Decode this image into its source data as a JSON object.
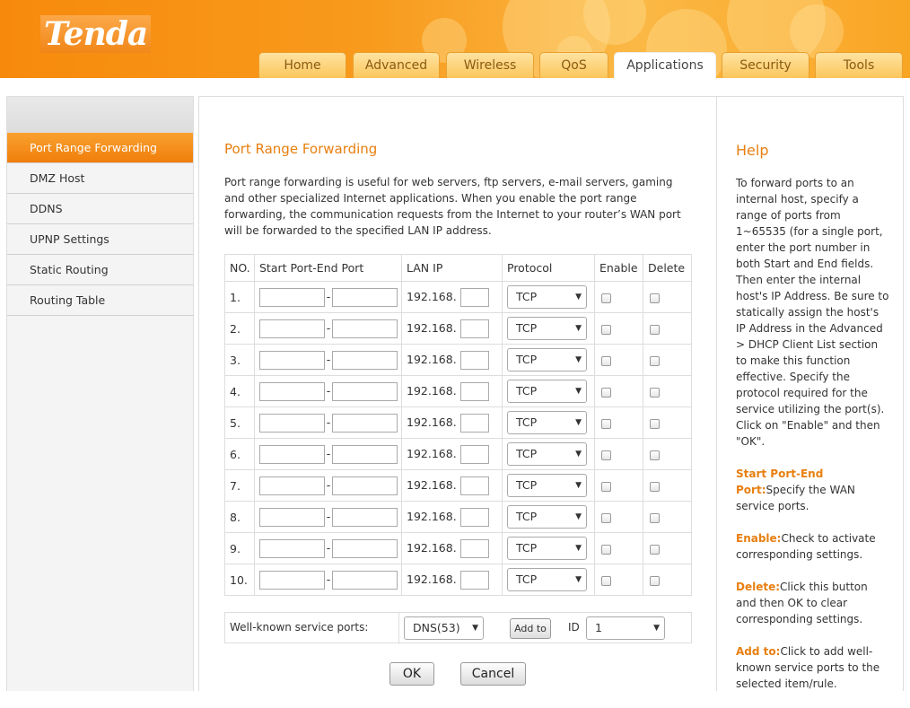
{
  "brand": {
    "logo_text": "Tenda"
  },
  "nav": {
    "tabs": [
      "Home",
      "Advanced",
      "Wireless",
      "QoS",
      "Applications",
      "Security",
      "Tools"
    ],
    "active": "Applications"
  },
  "sidebar": {
    "items": [
      "Port Range Forwarding",
      "DMZ Host",
      "DDNS",
      "UPNP Settings",
      "Static Routing",
      "Routing Table"
    ],
    "active": "Port Range Forwarding"
  },
  "main": {
    "title": "Port Range Forwarding",
    "intro": "Port range forwarding is useful for web servers, ftp servers, e-mail servers, gaming and other specialized Internet applications. When you enable the port range forwarding, the communication requests from the Internet to your router’s WAN port will be forwarded to the specified LAN IP address.",
    "table": {
      "headers": {
        "no": "NO.",
        "ports": "Start Port-End Port",
        "lan_ip": "LAN IP",
        "protocol": "Protocol",
        "enable": "Enable",
        "delete": "Delete"
      },
      "rows": [
        {
          "no": "1.",
          "ip_prefix": "192.168.",
          "protocol": "TCP"
        },
        {
          "no": "2.",
          "ip_prefix": "192.168.",
          "protocol": "TCP"
        },
        {
          "no": "3.",
          "ip_prefix": "192.168.",
          "protocol": "TCP"
        },
        {
          "no": "4.",
          "ip_prefix": "192.168.",
          "protocol": "TCP"
        },
        {
          "no": "5.",
          "ip_prefix": "192.168.",
          "protocol": "TCP"
        },
        {
          "no": "6.",
          "ip_prefix": "192.168.",
          "protocol": "TCP"
        },
        {
          "no": "7.",
          "ip_prefix": "192.168.",
          "protocol": "TCP"
        },
        {
          "no": "8.",
          "ip_prefix": "192.168.",
          "protocol": "TCP"
        },
        {
          "no": "9.",
          "ip_prefix": "192.168.",
          "protocol": "TCP"
        },
        {
          "no": "10.",
          "ip_prefix": "192.168.",
          "protocol": "TCP"
        }
      ]
    },
    "well_known": {
      "label": "Well-known service ports:",
      "service_value": "DNS(53)",
      "add_button": "Add to",
      "id_label": "ID",
      "id_value": "1"
    },
    "ok_button": "OK",
    "cancel_button": "Cancel"
  },
  "help": {
    "title": "Help",
    "intro": "To forward ports to an internal host, specify a range of ports from 1~65535 (for a single port, enter the port number in both Start and End fields. Then enter the internal host's IP Address. Be sure to statically assign the host's IP Address in the Advanced > DHCP Client List section to make this function effective. Specify the protocol required for the service utilizing the port(s). Click on \"Enable\" and then \"OK\".",
    "items": [
      {
        "term": "Start Port-End Port:",
        "text": "Specify the WAN service ports."
      },
      {
        "term": "Enable:",
        "text": "Check to activate corresponding settings."
      },
      {
        "term": "Delete:",
        "text": "Click this button and then OK to clear corresponding settings."
      },
      {
        "term": "Add to:",
        "text": "Click to add well-known service ports to the selected item/rule."
      }
    ]
  },
  "colors": {
    "accent": "#e87f10",
    "header_orange": "#f78a0c",
    "sidebar_active": "#f28a1a"
  },
  "icons": {
    "dropdown": "dropdown-arrow-icon",
    "checkbox": "checkbox-icon"
  }
}
